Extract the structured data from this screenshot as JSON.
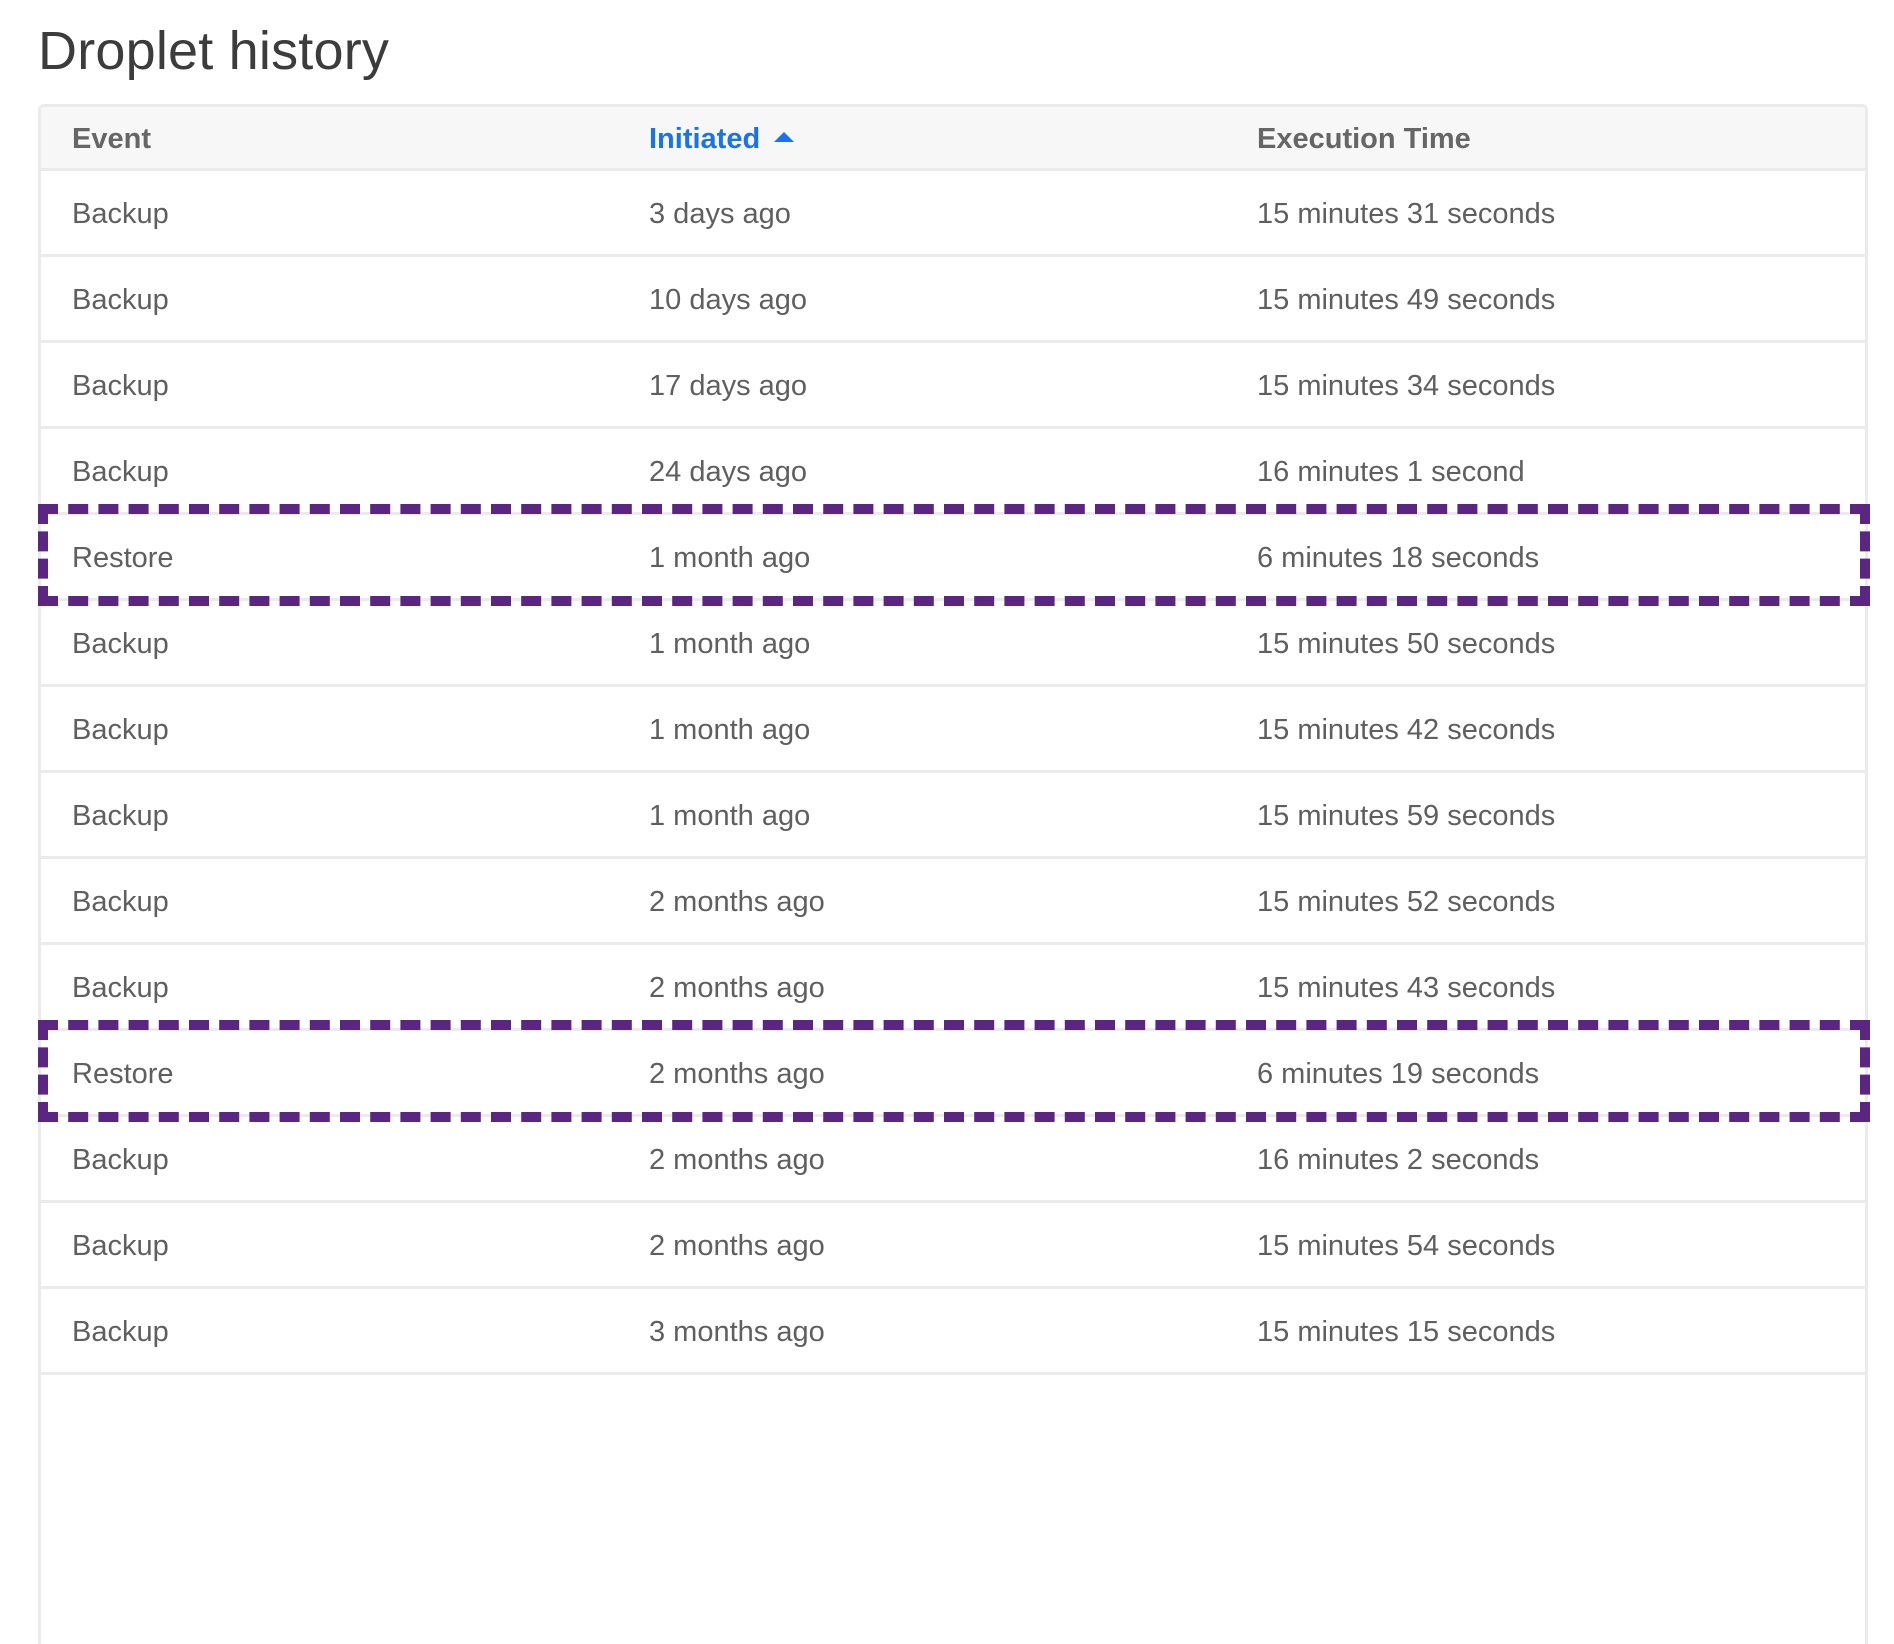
{
  "page": {
    "title": "Droplet history"
  },
  "table": {
    "columns": [
      {
        "label": "Event"
      },
      {
        "label": "Initiated",
        "sorted": true,
        "sort_direction": "ascending"
      },
      {
        "label": "Execution Time"
      }
    ],
    "rows": [
      {
        "event": "Backup",
        "initiated": "3 days ago",
        "execution_time": "15 minutes 31 seconds"
      },
      {
        "event": "Backup",
        "initiated": "10 days ago",
        "execution_time": "15 minutes 49 seconds"
      },
      {
        "event": "Backup",
        "initiated": "17 days ago",
        "execution_time": "15 minutes 34 seconds"
      },
      {
        "event": "Backup",
        "initiated": "24 days ago",
        "execution_time": "16 minutes 1 second"
      },
      {
        "event": "Restore",
        "initiated": "1 month ago",
        "execution_time": "6 minutes 18 seconds",
        "highlighted": true
      },
      {
        "event": "Backup",
        "initiated": "1 month ago",
        "execution_time": "15 minutes 50 seconds"
      },
      {
        "event": "Backup",
        "initiated": "1 month ago",
        "execution_time": "15 minutes 42 seconds"
      },
      {
        "event": "Backup",
        "initiated": "1 month ago",
        "execution_time": "15 minutes 59 seconds"
      },
      {
        "event": "Backup",
        "initiated": "2 months ago",
        "execution_time": "15 minutes 52 seconds"
      },
      {
        "event": "Backup",
        "initiated": "2 months ago",
        "execution_time": "15 minutes 43 seconds"
      },
      {
        "event": "Restore",
        "initiated": "2 months ago",
        "execution_time": "6 minutes 19 seconds",
        "highlighted": true
      },
      {
        "event": "Backup",
        "initiated": "2 months ago",
        "execution_time": "16 minutes 2 seconds"
      },
      {
        "event": "Backup",
        "initiated": "2 months ago",
        "execution_time": "15 minutes 54 seconds"
      },
      {
        "event": "Backup",
        "initiated": "3 months ago",
        "execution_time": "15 minutes 15 seconds"
      }
    ]
  },
  "colors": {
    "accent": "#1a73e8",
    "highlight_border": "#5b2682",
    "header_bg": "#f7f7f7",
    "divider": "#ebebeb",
    "text": "#5f5f5f"
  },
  "icons": {
    "sort": "sort-ascending-icon"
  }
}
